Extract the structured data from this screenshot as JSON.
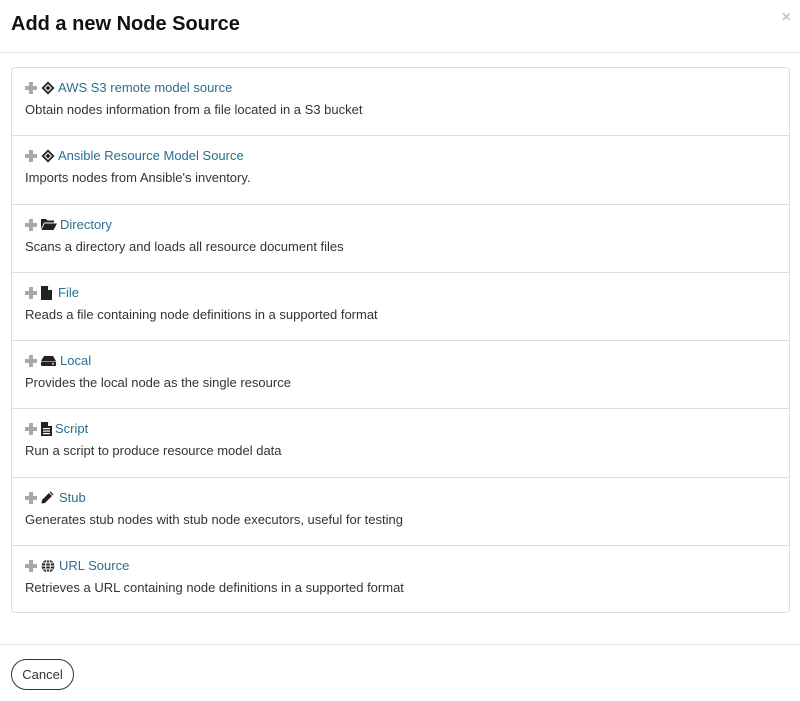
{
  "modal": {
    "title": "Add a new Node Source",
    "close_label": "×"
  },
  "sources": [
    {
      "icon": "diamond-icon",
      "title": "AWS S3 remote model source",
      "description": "Obtain nodes information from a file located in a S3 bucket"
    },
    {
      "icon": "diamond-icon",
      "title": "Ansible Resource Model Source",
      "description": "Imports nodes from Ansible's inventory."
    },
    {
      "icon": "folder-open-icon",
      "title": "Directory",
      "description": "Scans a directory and loads all resource document files"
    },
    {
      "icon": "file-icon",
      "title": "File",
      "description": "Reads a file containing node definitions in a supported format"
    },
    {
      "icon": "hdd-icon",
      "title": "Local",
      "description": "Provides the local node as the single resource"
    },
    {
      "icon": "file-text-icon",
      "title": "Script",
      "description": "Run a script to produce resource model data"
    },
    {
      "icon": "pencil-icon",
      "title": "Stub",
      "description": "Generates stub nodes with stub node executors, useful for testing"
    },
    {
      "icon": "globe-icon",
      "title": "URL Source",
      "description": "Retrieves a URL containing node definitions in a supported format"
    }
  ],
  "footer": {
    "cancel_label": "Cancel"
  }
}
